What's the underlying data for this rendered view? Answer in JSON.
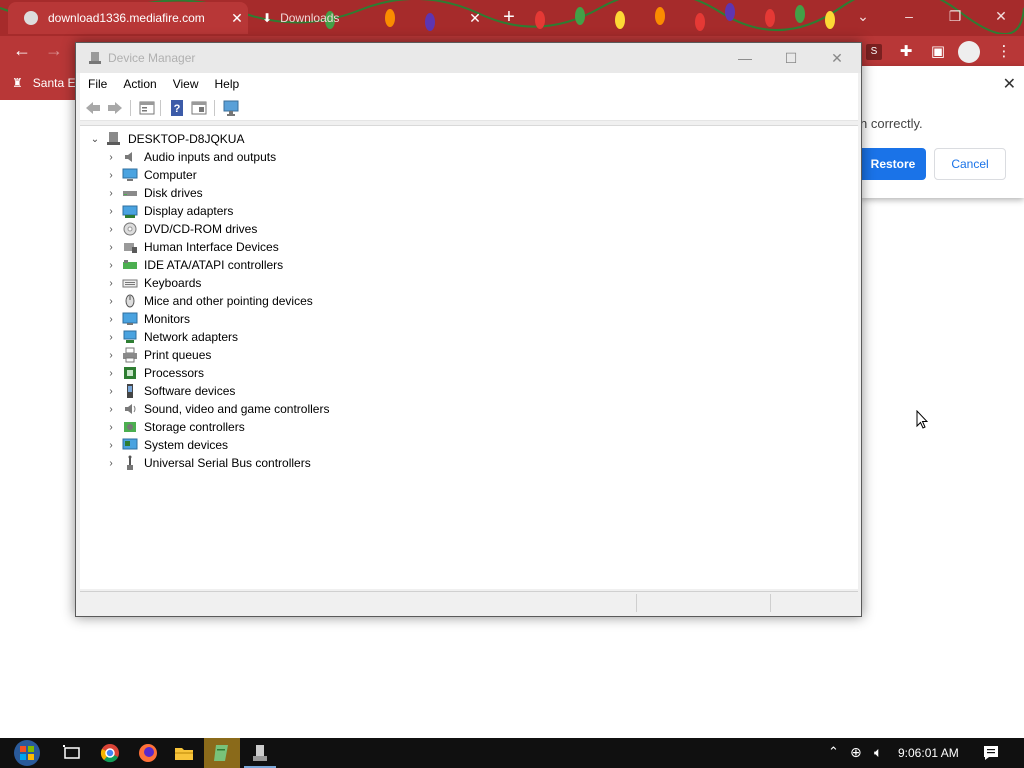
{
  "browser": {
    "tabs": [
      {
        "title": "download1336.mediafire.com",
        "active": true
      },
      {
        "title": "Downloads",
        "active": false
      }
    ],
    "bookmark_label": "Santa E",
    "extension_badge": "S",
    "restore_popup": {
      "message": "n correctly.",
      "restore_label": "Restore",
      "cancel_label": "Cancel"
    }
  },
  "device_manager": {
    "title": "Device Manager",
    "menu": [
      "File",
      "Action",
      "View",
      "Help"
    ],
    "root": "DESKTOP-D8JQKUA",
    "items": [
      {
        "label": "Audio inputs and outputs",
        "icon": "speaker-icon"
      },
      {
        "label": "Computer",
        "icon": "computer-icon"
      },
      {
        "label": "Disk drives",
        "icon": "disk-drive-icon"
      },
      {
        "label": "Display adapters",
        "icon": "display-adapter-icon"
      },
      {
        "label": "DVD/CD-ROM drives",
        "icon": "dvd-icon"
      },
      {
        "label": "Human Interface Devices",
        "icon": "hid-icon"
      },
      {
        "label": "IDE ATA/ATAPI controllers",
        "icon": "ide-controller-icon"
      },
      {
        "label": "Keyboards",
        "icon": "keyboard-icon"
      },
      {
        "label": "Mice and other pointing devices",
        "icon": "mouse-icon"
      },
      {
        "label": "Monitors",
        "icon": "monitor-icon"
      },
      {
        "label": "Network adapters",
        "icon": "network-adapter-icon"
      },
      {
        "label": "Print queues",
        "icon": "printer-icon"
      },
      {
        "label": "Processors",
        "icon": "processor-icon"
      },
      {
        "label": "Software devices",
        "icon": "software-device-icon"
      },
      {
        "label": "Sound, video and game controllers",
        "icon": "sound-controller-icon"
      },
      {
        "label": "Storage controllers",
        "icon": "storage-controller-icon"
      },
      {
        "label": "System devices",
        "icon": "system-device-icon"
      },
      {
        "label": "Universal Serial Bus controllers",
        "icon": "usb-icon"
      }
    ]
  },
  "taskbar": {
    "time": "9:06:01 AM"
  },
  "colors": {
    "chrome_frame": "#a62b2b",
    "chrome_toolbar": "#b83737",
    "accent_blue": "#1a73e8"
  }
}
